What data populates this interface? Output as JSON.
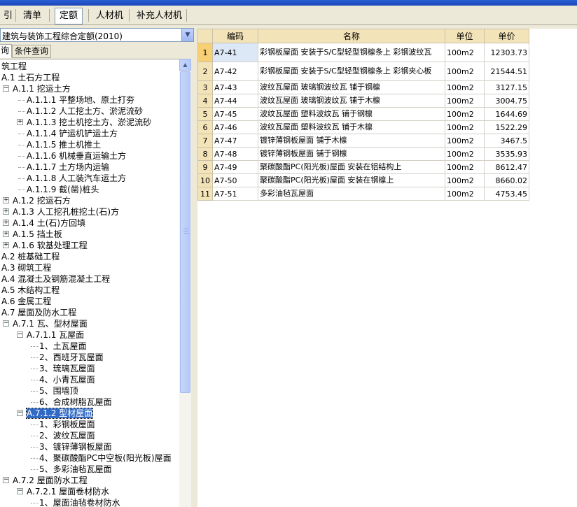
{
  "tabs": [
    {
      "label": "引"
    },
    {
      "label": "清单"
    },
    {
      "label": "定额",
      "active": true
    },
    {
      "label": "人材机"
    },
    {
      "label": "补充人材机"
    }
  ],
  "library_select": {
    "value": "建筑与装饰工程综合定额(2010)"
  },
  "subtabs": [
    {
      "label": "询"
    },
    {
      "label": "条件查询"
    }
  ],
  "tree": {
    "items": [
      {
        "label": "筑工程",
        "level": 0
      },
      {
        "label": "A.1 土石方工程",
        "level": 0
      },
      {
        "label": "A.1.1 挖运土方",
        "level": 1,
        "expander": "−"
      },
      {
        "label": "A.1.1.1 平整场地、原土打夯",
        "level": 2
      },
      {
        "label": "A.1.1.2 人工挖土方、淤泥流砂",
        "level": 2
      },
      {
        "label": "A.1.1.3 挖土机挖土方、淤泥流砂",
        "level": 2,
        "expander": "+"
      },
      {
        "label": "A.1.1.4 铲运机铲运土方",
        "level": 2
      },
      {
        "label": "A.1.1.5 推土机推土",
        "level": 2
      },
      {
        "label": "A.1.1.6 机械垂直运输土方",
        "level": 2
      },
      {
        "label": "A.1.1.7 土方场内运输",
        "level": 2
      },
      {
        "label": "A.1.1.8 人工装汽车运土方",
        "level": 2
      },
      {
        "label": "A.1.1.9 截(凿)桩头",
        "level": 2
      },
      {
        "label": "A.1.2 挖运石方",
        "level": 1,
        "expander": "+"
      },
      {
        "label": "A.1.3 人工挖孔桩挖土(石)方",
        "level": 1,
        "expander": "+"
      },
      {
        "label": "A.1.4 土(石)方回填",
        "level": 1,
        "expander": "+"
      },
      {
        "label": "A.1.5 挡土板",
        "level": 1,
        "expander": "+"
      },
      {
        "label": "A.1.6 软基处理工程",
        "level": 1,
        "expander": "+"
      },
      {
        "label": "A.2 桩基础工程",
        "level": 0
      },
      {
        "label": "A.3 砌筑工程",
        "level": 0
      },
      {
        "label": "A.4 混凝土及钢筋混凝土工程",
        "level": 0
      },
      {
        "label": "A.5 木结构工程",
        "level": 0
      },
      {
        "label": "A.6 金属工程",
        "level": 0
      },
      {
        "label": "A.7 屋面及防水工程",
        "level": 0
      },
      {
        "label": "A.7.1 瓦、型材屋面",
        "level": 1,
        "expander": "−"
      },
      {
        "label": "A.7.1.1 瓦屋面",
        "level": 2,
        "expander": "−"
      },
      {
        "label": "1、土瓦屋面",
        "level": 3
      },
      {
        "label": "2、西班牙瓦屋面",
        "level": 3
      },
      {
        "label": "3、琉璃瓦屋面",
        "level": 3
      },
      {
        "label": "4、小青瓦屋面",
        "level": 3
      },
      {
        "label": "5、围墙顶",
        "level": 3
      },
      {
        "label": "6、合成树脂瓦屋面",
        "level": 3
      },
      {
        "label": "A.7.1.2 型材屋面",
        "level": 2,
        "expander": "−",
        "selected": true
      },
      {
        "label": "1、彩钢板屋面",
        "level": 3
      },
      {
        "label": "2、波纹瓦屋面",
        "level": 3
      },
      {
        "label": "3、镀锌薄钢板屋面",
        "level": 3
      },
      {
        "label": "4、聚碳酸酯PC中空板(阳光板)屋面",
        "level": 3
      },
      {
        "label": "5、多彩油毡瓦屋面",
        "level": 3
      },
      {
        "label": "A.7.2 屋面防水工程",
        "level": 1,
        "expander": "−"
      },
      {
        "label": "A.7.2.1 屋面卷材防水",
        "level": 2,
        "expander": "−"
      },
      {
        "label": "1、屋面油毡卷材防水",
        "level": 3
      }
    ]
  },
  "grid": {
    "columns": [
      "编码",
      "名称",
      "单位",
      "单价"
    ],
    "rows": [
      {
        "num": "1",
        "code": "A7-41",
        "name": "彩钢板屋面 安装于S/C型轻型钢檩条上 彩钢波纹瓦",
        "unit": "100m2",
        "price": "12303.73"
      },
      {
        "num": "2",
        "code": "A7-42",
        "name": "彩钢板屋面 安装于S/C型轻型钢檩条上 彩钢夹心板",
        "unit": "100m2",
        "price": "21544.51"
      },
      {
        "num": "3",
        "code": "A7-43",
        "name": "波纹瓦屋面 玻璃钢波纹瓦 铺于钢檩",
        "unit": "100m2",
        "price": "3127.15"
      },
      {
        "num": "4",
        "code": "A7-44",
        "name": "波纹瓦屋面 玻璃钢波纹瓦 铺于木檩",
        "unit": "100m2",
        "price": "3004.75"
      },
      {
        "num": "5",
        "code": "A7-45",
        "name": "波纹瓦屋面 塑料波纹瓦 铺于钢檩",
        "unit": "100m2",
        "price": "1644.69"
      },
      {
        "num": "6",
        "code": "A7-46",
        "name": "波纹瓦屋面 塑料波纹瓦 铺于木檩",
        "unit": "100m2",
        "price": "1522.29"
      },
      {
        "num": "7",
        "code": "A7-47",
        "name": "镀锌薄钢板屋面 铺于木檩",
        "unit": "100m2",
        "price": "3467.5"
      },
      {
        "num": "8",
        "code": "A7-48",
        "name": "镀锌薄钢板屋面 铺于钢檩",
        "unit": "100m2",
        "price": "3535.93"
      },
      {
        "num": "9",
        "code": "A7-49",
        "name": "聚碳酸酯PC(阳光板)屋面 安装在铝结构上",
        "unit": "100m2",
        "price": "8612.47"
      },
      {
        "num": "10",
        "code": "A7-50",
        "name": "聚碳酸酯PC(阳光板)屋面 安装在钢檩上",
        "unit": "100m2",
        "price": "8660.02"
      },
      {
        "num": "11",
        "code": "A7-51",
        "name": "多彩油毡瓦屋面",
        "unit": "100m2",
        "price": "4753.45"
      }
    ]
  },
  "colors": {
    "header_bg": "#f3e3b8",
    "selected_row_header": "#f7cf74",
    "tree_selection": "#316ac5"
  }
}
